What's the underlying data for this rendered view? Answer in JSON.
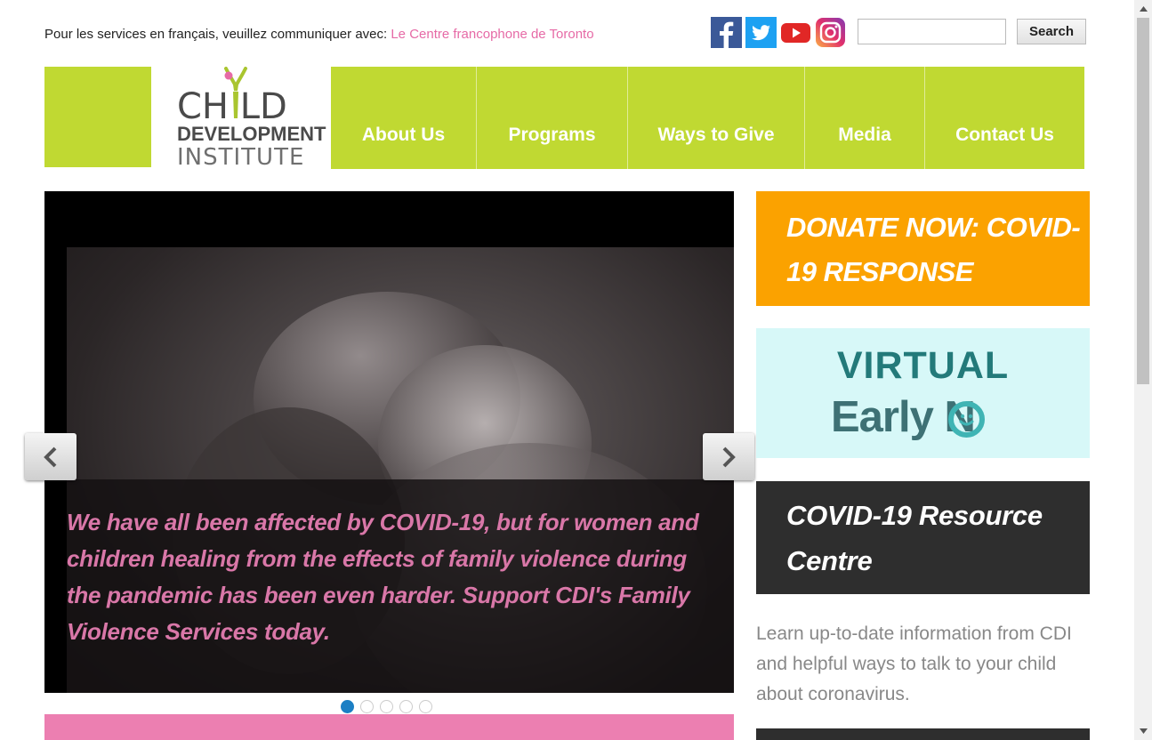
{
  "topbar": {
    "text": "Pour les services en français, veuillez communiquer avec:",
    "link": "Le Centre francophone de Toronto"
  },
  "social": {
    "icons": [
      "facebook-icon",
      "twitter-icon",
      "youtube-icon",
      "instagram-icon"
    ]
  },
  "search": {
    "value": "",
    "button_label": "Search"
  },
  "logo": {
    "line1": "CH  LD",
    "line2": "DEVELOPMENT",
    "line3": "INSTITUTE"
  },
  "nav": {
    "items": [
      {
        "label": "About Us"
      },
      {
        "label": "Programs"
      },
      {
        "label": "Ways to Give"
      },
      {
        "label": "Media"
      },
      {
        "label": "Contact Us"
      }
    ]
  },
  "slider": {
    "caption": "We have all been affected by COVID-19, but for women and children healing from the effects of family violence during the pandemic has been even harder. Support CDI's Family Violence Services today.",
    "dot_count": 5,
    "active_dot": 0
  },
  "sidebar": {
    "donate": "DONATE NOW: COVID-19 RESPONSE",
    "earlyon_line1": "VIRTUAL",
    "earlyon_line2": "Early  N",
    "covid_title": "COVID-19 Resource Centre",
    "covid_text": "Learn up-to-date information from CDI and helpful ways to talk to your child about coronavirus."
  },
  "colors": {
    "brand_green": "#c0d932",
    "brand_pink": "#e66aa6",
    "donate_orange": "#fba200",
    "dark_panel": "#2e2e2e",
    "earlyon_bg": "#d7f8f8"
  }
}
